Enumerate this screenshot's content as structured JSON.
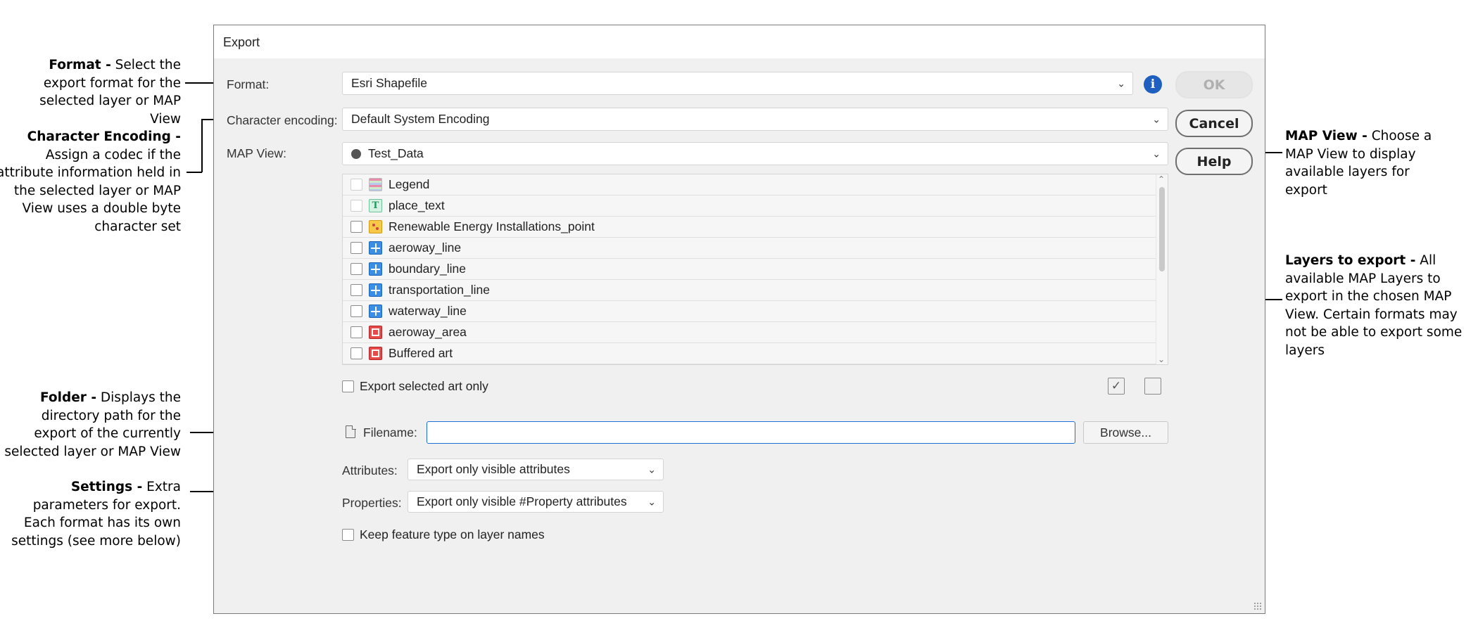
{
  "annotations": {
    "format": {
      "title": "Format -",
      "text": "Select the export format for the selected layer or MAP View"
    },
    "character_encoding": {
      "title": "Character Encoding -",
      "text": "Assign a codec if the attribute information held in the selected layer or MAP View uses a double byte character set"
    },
    "folder": {
      "title": "Folder -",
      "text": "Displays the directory path for the export of the currently selected layer or MAP View"
    },
    "settings": {
      "title": "Settings -",
      "text": "Extra parameters for export. Each format has its own settings (see more below)"
    },
    "map_view": {
      "title": "MAP View -",
      "text": "Choose a MAP View to display available layers for export"
    },
    "layers_to_export": {
      "title": "Layers to export -",
      "text": "All available MAP Layers to export in the chosen MAP View. Certain formats may not be able to export some layers"
    }
  },
  "dialog": {
    "title": "Export",
    "format_label": "Format:",
    "format_value": "Esri Shapefile",
    "encoding_label": "Character encoding:",
    "encoding_value": "Default System Encoding",
    "mapview_label": "MAP View:",
    "mapview_value": "Test_Data",
    "buttons": {
      "ok": "OK",
      "cancel": "Cancel",
      "help": "Help"
    },
    "info_icon_glyph": "i",
    "layers": [
      {
        "name": "Legend",
        "icon": "legend-icon",
        "enabled": false
      },
      {
        "name": "place_text",
        "icon": "text-layer-icon",
        "enabled": false
      },
      {
        "name": "Renewable Energy Installations_point",
        "icon": "point-layer-icon",
        "enabled": true
      },
      {
        "name": "aeroway_line",
        "icon": "line-layer-icon",
        "enabled": true
      },
      {
        "name": "boundary_line",
        "icon": "line-layer-icon",
        "enabled": true
      },
      {
        "name": "transportation_line",
        "icon": "line-layer-icon",
        "enabled": true
      },
      {
        "name": "waterway_line",
        "icon": "line-layer-icon",
        "enabled": true
      },
      {
        "name": "aeroway_area",
        "icon": "area-layer-icon",
        "enabled": true
      },
      {
        "name": "Buffered art",
        "icon": "area-layer-icon",
        "enabled": true
      }
    ],
    "export_selected_label": "Export selected art only",
    "filename_label": "Filename:",
    "filename_value": "",
    "browse_label": "Browse...",
    "attributes_label": "Attributes:",
    "attributes_value": "Export only visible attributes",
    "properties_label": "Properties:",
    "properties_value": "Export only visible #Property attributes",
    "keep_feature_label": "Keep feature type on layer names",
    "colors": {
      "accent": "#1f5fbf",
      "focus": "#1e6fd6"
    }
  }
}
